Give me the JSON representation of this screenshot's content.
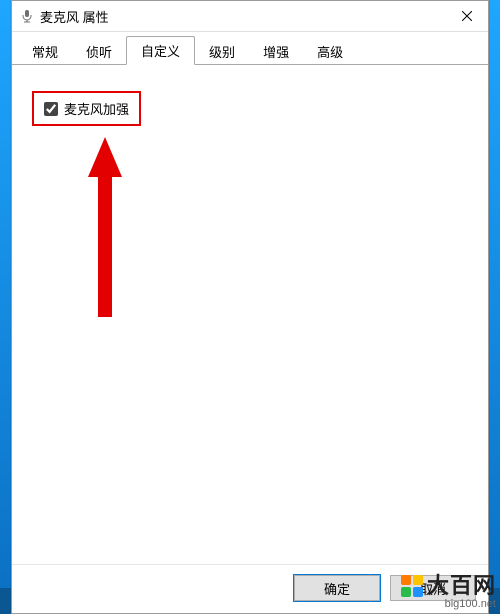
{
  "window": {
    "title": "麦克风 属性"
  },
  "tabs": [
    {
      "label": "常规"
    },
    {
      "label": "侦听"
    },
    {
      "label": "自定义"
    },
    {
      "label": "级别"
    },
    {
      "label": "增强"
    },
    {
      "label": "高级"
    }
  ],
  "active_tab_index": 2,
  "checkbox": {
    "label": "麦克风加强",
    "checked": true
  },
  "buttons": {
    "ok": "确定",
    "cancel": "取消"
  },
  "annotation": {
    "highlight_color": "#e30000"
  },
  "watermark": {
    "brand": "大百网",
    "url": "big100.net",
    "dot_colors": [
      "#ff7a00",
      "#ffc400",
      "#28bd4b",
      "#1e90ff"
    ]
  }
}
